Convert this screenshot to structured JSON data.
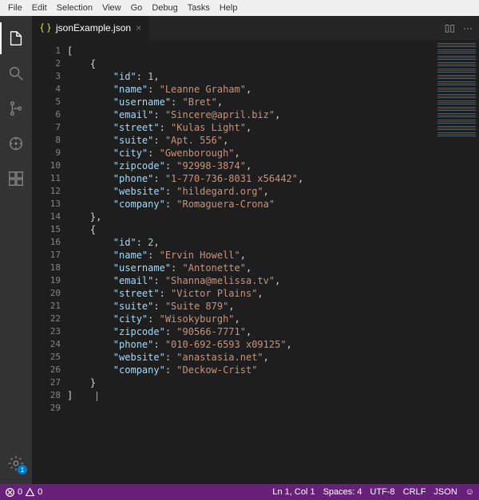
{
  "menubar": [
    "File",
    "Edit",
    "Selection",
    "View",
    "Go",
    "Debug",
    "Tasks",
    "Help"
  ],
  "activitybar": {
    "items": [
      "files-icon",
      "search-icon",
      "source-control-icon",
      "debug-icon",
      "extensions-icon"
    ],
    "settings_badge": "1"
  },
  "tab": {
    "filename": "jsonExample.json",
    "close": "×"
  },
  "tab_actions": {
    "split": "▯▯",
    "more": "···"
  },
  "code": {
    "last_line": 29,
    "records": [
      {
        "id": 1,
        "name": "Leanne Graham",
        "username": "Bret",
        "email": "Sincere@april.biz",
        "street": "Kulas Light",
        "suite": "Apt. 556",
        "city": "Gwenborough",
        "zipcode": "92998-3874",
        "phone": "1-770-736-8031 x56442",
        "website": "hildegard.org",
        "company": "Romaguera-Crona"
      },
      {
        "id": 2,
        "name": "Ervin Howell",
        "username": "Antonette",
        "email": "Shanna@melissa.tv",
        "street": "Victor Plains",
        "suite": "Suite 879",
        "city": "Wisokyburgh",
        "zipcode": "90566-7771",
        "phone": "010-692-6593 x09125",
        "website": "anastasia.net",
        "company": "Deckow-Crist"
      }
    ]
  },
  "status": {
    "errors_icon": "⊘",
    "errors": "0",
    "warnings_icon": "⚠",
    "warnings": "0",
    "cursor": "Ln 1, Col 1",
    "spaces": "Spaces: 4",
    "encoding": "UTF-8",
    "eol": "CRLF",
    "lang": "JSON",
    "feedback": "☺"
  }
}
